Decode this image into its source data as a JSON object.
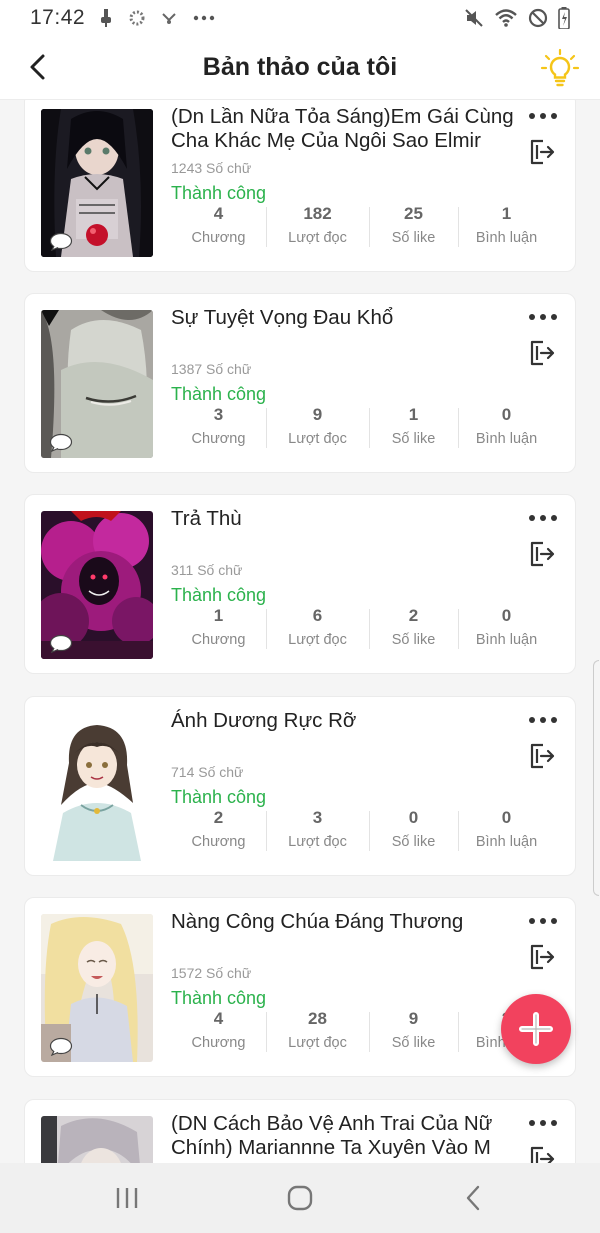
{
  "status_bar": {
    "time": "17:42",
    "left_icons": [
      "usb-icon",
      "settings-dot-icon",
      "data-transfer-icon",
      "more-notifications-icon"
    ],
    "right_icons": [
      "mute-icon",
      "wifi-icon",
      "do-not-disturb-icon",
      "battery-icon"
    ]
  },
  "header": {
    "title": "Bản thảo của tôi",
    "back_icon": "chevron-left-icon",
    "idea_icon": "lightbulb-icon",
    "accent_color": "#f5c518"
  },
  "stat_labels": {
    "chapters": "Chương",
    "reads": "Lượt đọc",
    "likes": "Số like",
    "comments": "Bình luận"
  },
  "drafts": [
    {
      "title": "(Dn Lần Nữa Tỏa Sáng)Em Gái Cùng Cha Khác Mẹ Của Ngôi Sao Elmir",
      "word_count": "1243 Số chữ",
      "status": "Thành công",
      "chapters": "4",
      "reads": "182",
      "likes": "25",
      "comments": "1"
    },
    {
      "title": "Sự Tuyệt Vọng Đau Khổ",
      "word_count": "1387 Số chữ",
      "status": "Thành công",
      "chapters": "3",
      "reads": "9",
      "likes": "1",
      "comments": "0"
    },
    {
      "title": "Trả Thù",
      "word_count": "311 Số chữ",
      "status": "Thành công",
      "chapters": "1",
      "reads": "6",
      "likes": "2",
      "comments": "0"
    },
    {
      "title": "Ánh Dương Rực Rỡ",
      "word_count": "714 Số chữ",
      "status": "Thành công",
      "chapters": "2",
      "reads": "3",
      "likes": "0",
      "comments": "0"
    },
    {
      "title": "Nàng Công Chúa Đáng Thương",
      "word_count": "1572 Số chữ",
      "status": "Thành công",
      "chapters": "4",
      "reads": "28",
      "likes": "9",
      "comments": "2"
    },
    {
      "title": "(DN Cách Bảo Vệ Anh Trai Của Nữ Chính) Mariannne Ta Xuyên Vào M",
      "word_count": "",
      "status": "",
      "chapters": "",
      "reads": "",
      "likes": "",
      "comments": ""
    }
  ],
  "fab": {
    "icon": "plus-icon",
    "color": "#f2425e"
  },
  "status_color": "#2bb24c",
  "nav_bar": {
    "recent_icon": "recent-apps-icon",
    "home_icon": "home-icon",
    "back_icon": "back-icon"
  }
}
